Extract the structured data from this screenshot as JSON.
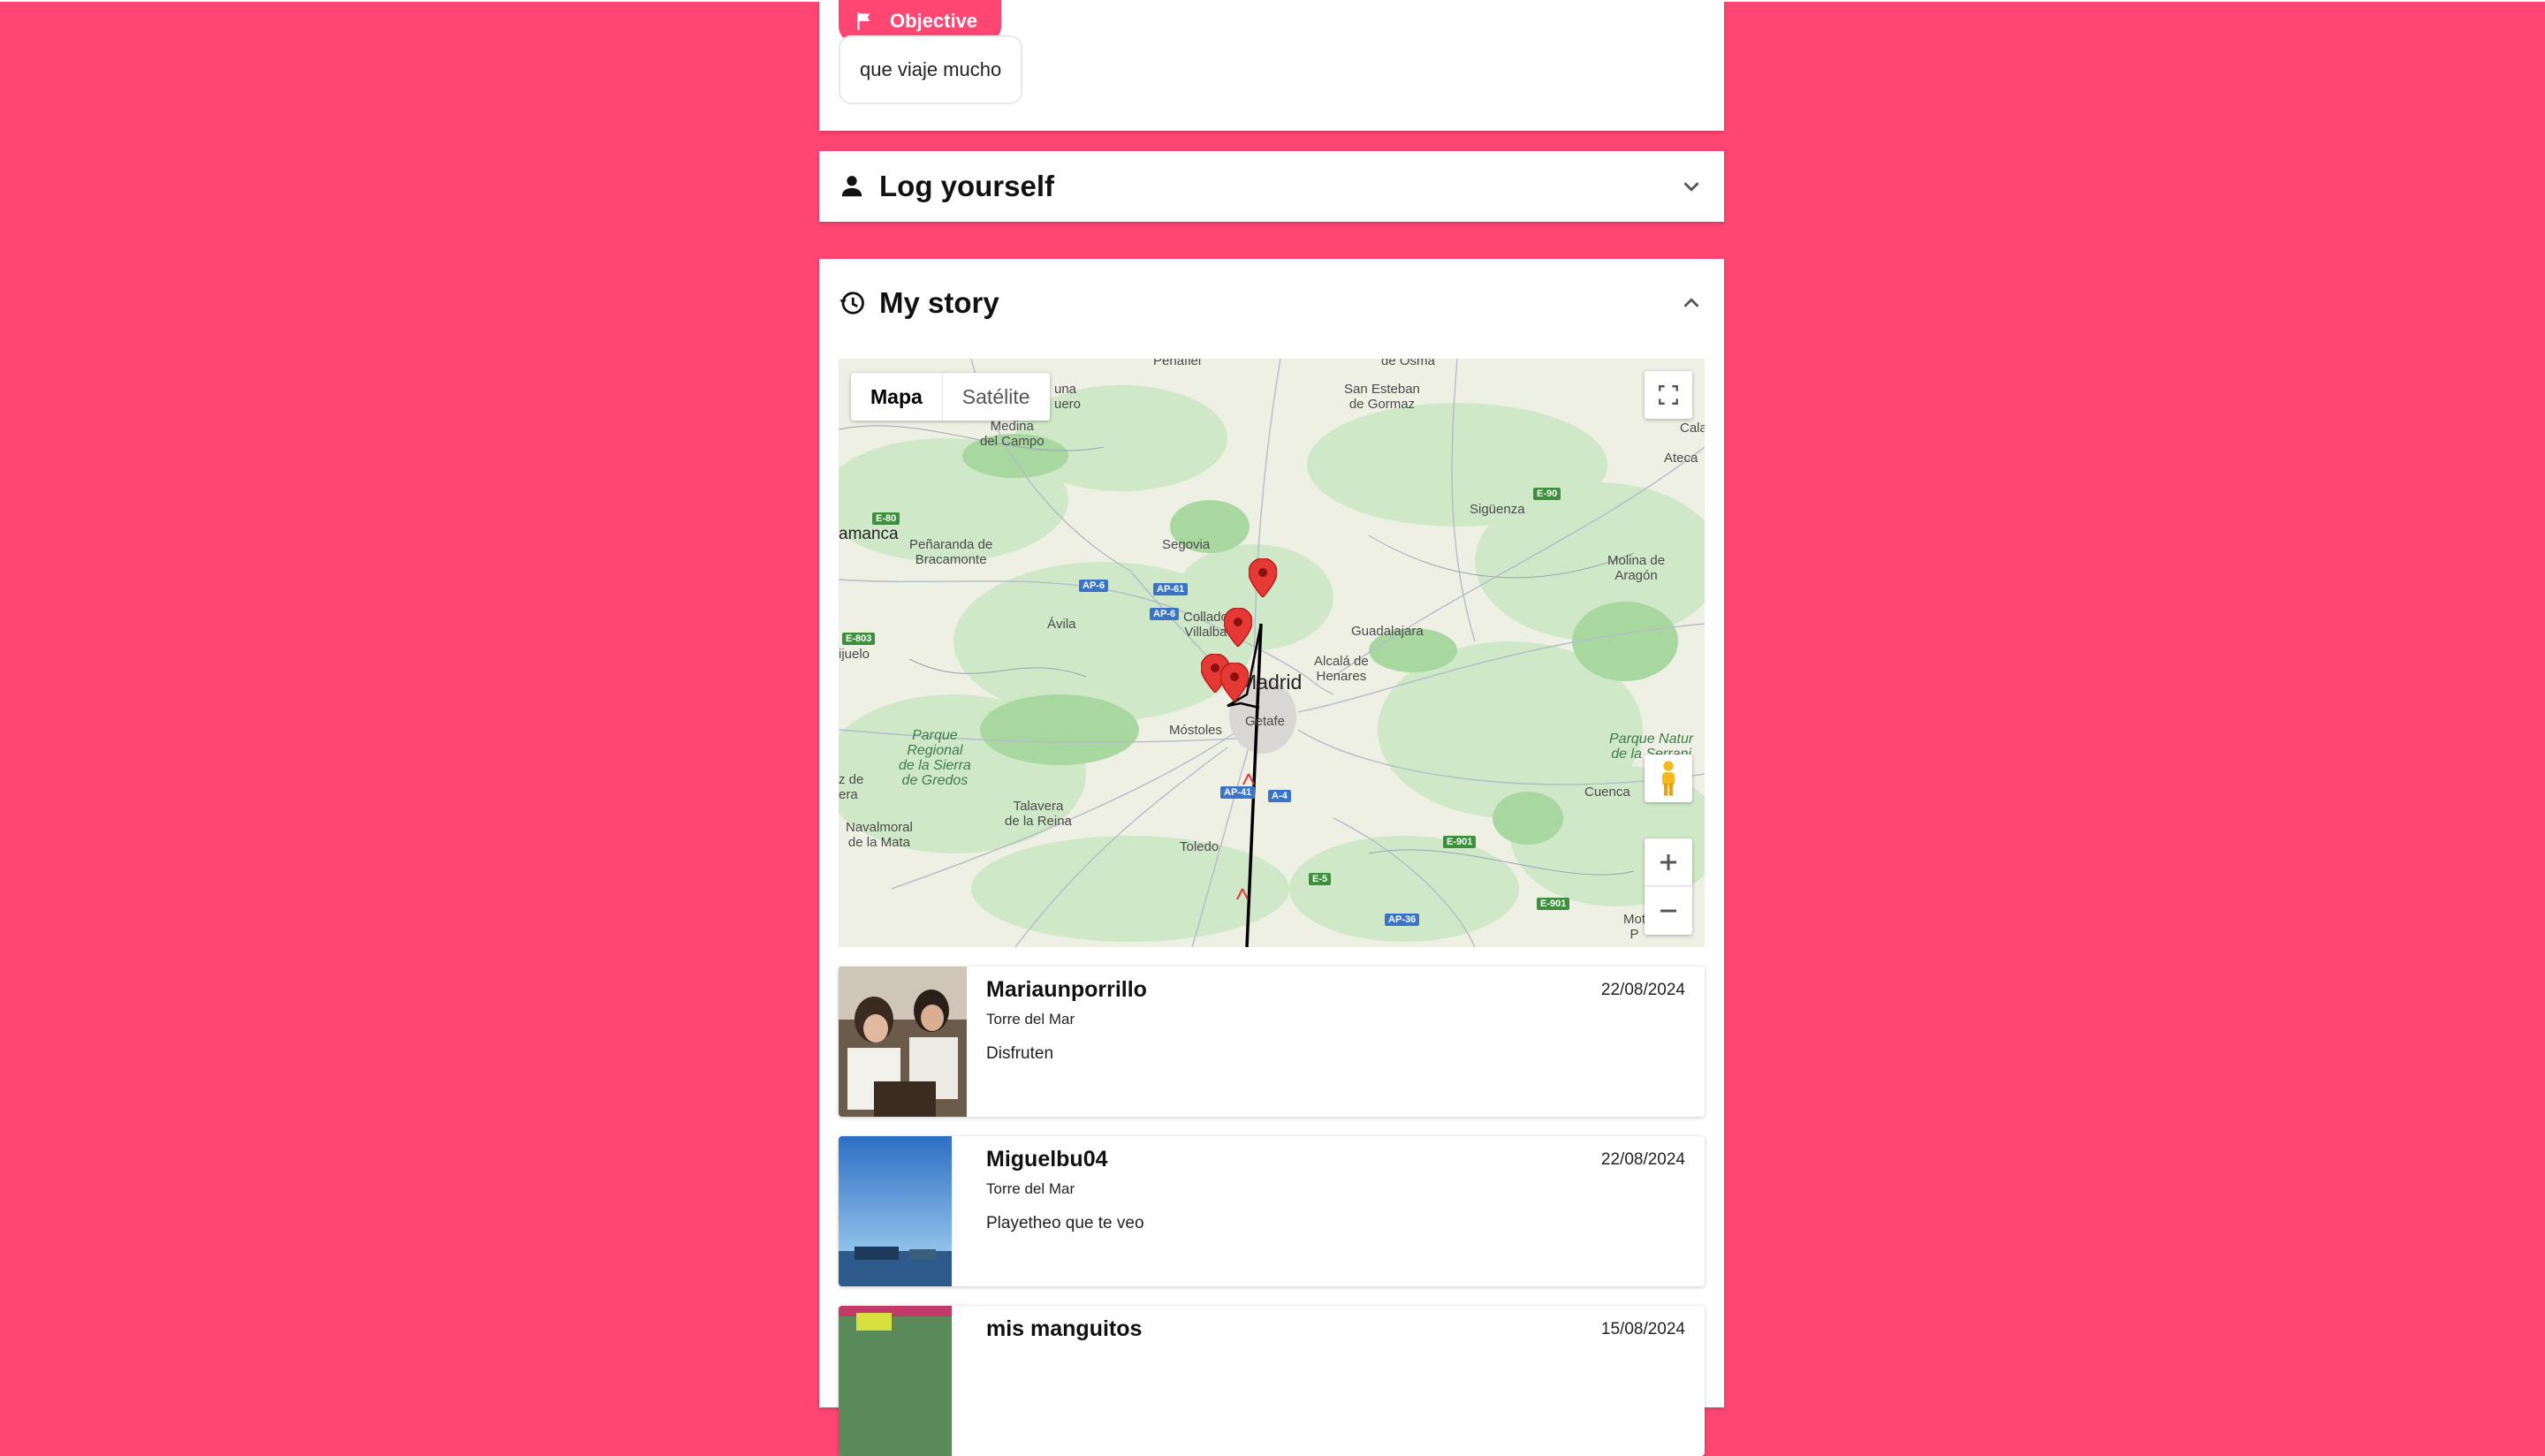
{
  "objective": {
    "chip_label": "Objective",
    "text": "que viaje mucho"
  },
  "log_section": {
    "title": "Log yourself"
  },
  "story_section": {
    "title": "My story"
  },
  "map": {
    "type_map": "Mapa",
    "type_satellite": "Satélite",
    "places": {
      "penafiel": "Peñafiel",
      "osma": "de Osma",
      "san_esteban": "San Esteban\nde Gormaz",
      "cuellar": "una\nuero",
      "medina": "Medina\ndel Campo",
      "cala": "Cala",
      "ateca": "Ateca",
      "siguenza": "Sigüenza",
      "salamanca": "amanca",
      "penaranda": "Peñaranda de\nBracamonte",
      "segovia": "Segovia",
      "molina": "Molina de\nAragón",
      "avila": "Ávila",
      "collado": "Collado\nVillalba",
      "guadalajara": "Guadalajara",
      "pujuelo": "ijuelo",
      "alcala": "Alcalá de\nHenares",
      "madrid": "Madrid",
      "mostoles": "Móstoles",
      "getafe": "Getafe",
      "gredos": "Parque\nRegional\nde la Sierra\nde Gredos",
      "parque_natural": "Parque Natur\nde la Serrani",
      "za_de": "z de\nera",
      "cuenca": "Cuenca",
      "talavera": "Talavera\nde la Reina",
      "navalmoral": "Navalmoral\nde la Mata",
      "toledo": "Toledo",
      "mot": "Mot\nP"
    },
    "roads": {
      "e80": "E-80",
      "ap6": "AP-6",
      "ap61": "AP-61",
      "ap6b": "AP-6",
      "e803": "E-803",
      "e90": "E-90",
      "ap41": "AP-41",
      "a4": "A-4",
      "e5": "E-5",
      "e901": "E-901",
      "e901b": "E-901",
      "ap36": "AP-36"
    },
    "pin_color": "#e53935"
  },
  "posts": [
    {
      "user": "Mariaunporrillo",
      "location": "Torre del Mar",
      "message": "Disfruten",
      "date": "22/08/2024"
    },
    {
      "user": "Miguelbu04",
      "location": "Torre del Mar",
      "message": "Playetheo que te veo",
      "date": "22/08/2024"
    },
    {
      "user": "mis manguitos",
      "location": "",
      "message": "",
      "date": "15/08/2024"
    }
  ],
  "colors": {
    "background": "#ff4571",
    "accent": "#ff4571"
  }
}
